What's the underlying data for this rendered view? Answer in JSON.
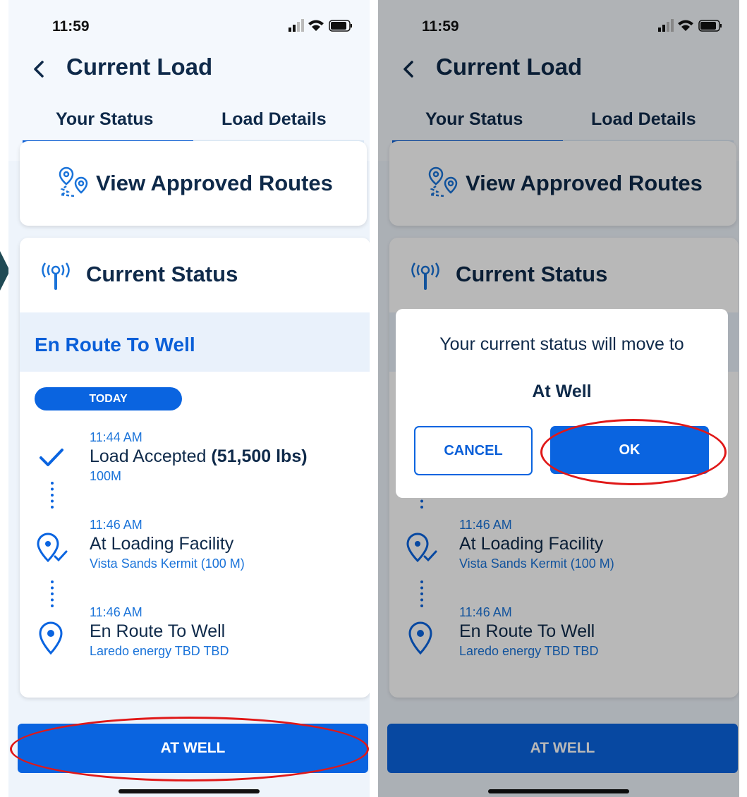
{
  "status_bar": {
    "time": "11:59"
  },
  "header": {
    "title": "Current Load",
    "back_label": "<"
  },
  "tabs": [
    {
      "label": "Your Status",
      "active": true
    },
    {
      "label": "Load Details",
      "active": false
    }
  ],
  "routes_card": {
    "label": "View Approved Routes",
    "icon": "route-pins-icon"
  },
  "status_card": {
    "title": "Current Status",
    "icon": "broadcast-icon",
    "current": "En Route To Well",
    "day_badge": "TODAY",
    "timeline": [
      {
        "time": "11:44 AM",
        "title": "Load Accepted",
        "weight": "(51,500 lbs)",
        "sub": "100M",
        "icon": "check-icon"
      },
      {
        "time": "11:46 AM",
        "title": "At Loading Facility",
        "sub": "Vista Sands Kermit (100 M)",
        "icon": "location-check-icon"
      },
      {
        "time": "11:46 AM",
        "title": "En Route To Well",
        "sub": "Laredo energy TBD TBD",
        "icon": "location-pin-icon"
      }
    ]
  },
  "action_button": {
    "label": "AT WELL"
  },
  "dialog": {
    "message": "Your current status will move to",
    "target": "At Well",
    "cancel_label": "CANCEL",
    "ok_label": "OK"
  },
  "colors": {
    "primary": "#0a64e0",
    "navy": "#0f2a4a",
    "highlight_ring": "#e01818"
  }
}
